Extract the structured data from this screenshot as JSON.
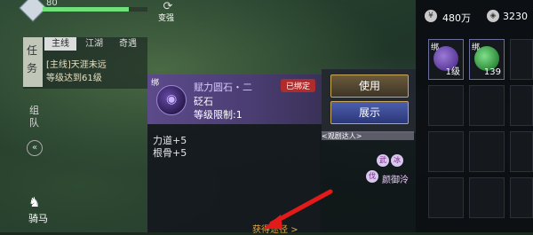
{
  "player": {
    "hp_text": "80",
    "hp_percent": 82
  },
  "top_action": {
    "icon": "swap-icon",
    "label": "变强"
  },
  "quest": {
    "side_title": [
      "任",
      "务"
    ],
    "tabs": [
      "主线",
      "江湖",
      "奇遇"
    ],
    "active_tab": 0,
    "line1": "[主线]天涯未远",
    "line2": "等级达到61级"
  },
  "left_buttons": {
    "team": [
      "组",
      "队"
    ],
    "collapse": "«",
    "horse_label": "骑马"
  },
  "tooltip": {
    "bind_mark": "绑",
    "item_name": "赋力圆石・二",
    "item_type": "砭石",
    "item_level": "等级限制:1",
    "bound_badge": "已绑定",
    "stats": [
      "力道+5",
      "根骨+5"
    ],
    "source": "获得途径 >"
  },
  "actions": {
    "use_label": "使用",
    "show_label": "展示",
    "ribbon_text": "<观剧达人>"
  },
  "inventory": {
    "currency1": "480万",
    "currency2": "3230",
    "slots": [
      {
        "bind": "绑",
        "count": "1级",
        "color": "#5b3a9a"
      },
      {
        "bind": "绑",
        "count": "139",
        "color": "#2f8a3a"
      }
    ]
  },
  "nameplate": {
    "badges": [
      "武",
      "冰",
      "伐"
    ],
    "label": "颜御泠"
  }
}
